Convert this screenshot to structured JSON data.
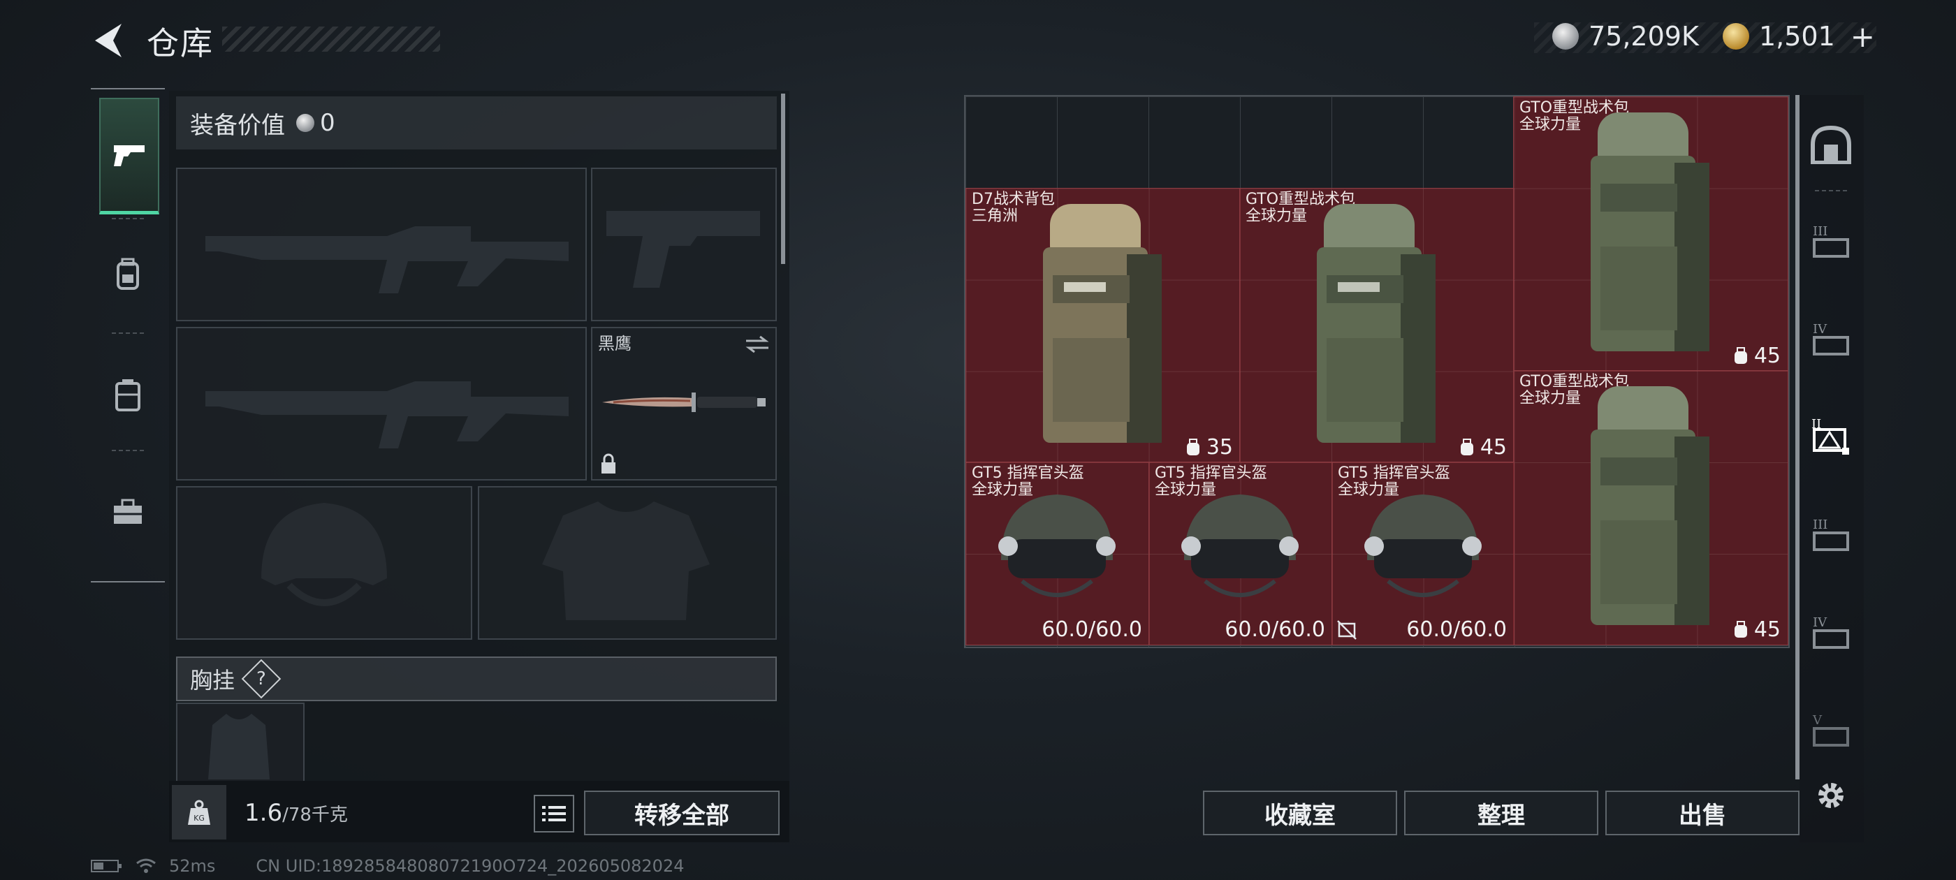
{
  "header": {
    "title": "仓库"
  },
  "currency": {
    "silver": "75,209K",
    "gold": "1,501"
  },
  "left_tabs": [
    "pistol-icon",
    "backpack-icon",
    "vest-icon",
    "toolbox-icon"
  ],
  "equipment": {
    "value_label": "装备价值",
    "value": "0",
    "melee_name": "黑鹰",
    "vest_label": "胸挂",
    "vest_help": "?"
  },
  "weight": {
    "current": "1.6",
    "max": "/78千克",
    "unit_icon": "KG"
  },
  "buttons": {
    "transfer_all": "转移全部",
    "collection": "收藏室",
    "organize": "整理",
    "sell": "出售"
  },
  "storage": {
    "items": [
      {
        "name": "D7战术背包",
        "brand": "三角洲",
        "stat": "35"
      },
      {
        "name": "GTO重型战术包",
        "brand": "全球力量",
        "stat": "45"
      },
      {
        "name": "GTO重型战术包",
        "brand": "全球力量",
        "stat": "45"
      },
      {
        "name": "GTO重型战术包",
        "brand": "全球力量",
        "stat": "45"
      },
      {
        "name": "GT5 指挥官头盔",
        "brand": "全球力量",
        "stat": "60.0/60.0"
      },
      {
        "name": "GT5 指挥官头盔",
        "brand": "全球力量",
        "stat": "60.0/60.0"
      },
      {
        "name": "GT5 指挥官头盔",
        "brand": "全球力量",
        "stat": "60.0/60.0"
      }
    ]
  },
  "status": {
    "ping": "52ms",
    "uid": "CN UID:18928584808072190O724_202605082024"
  }
}
